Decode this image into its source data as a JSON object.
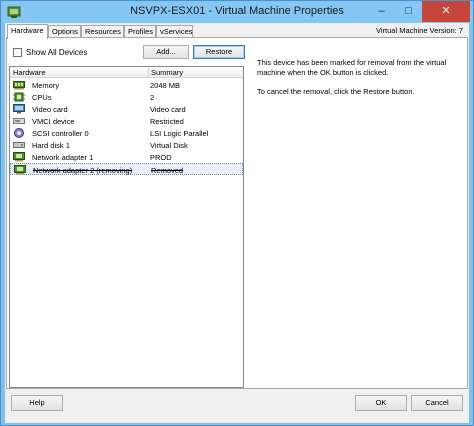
{
  "window": {
    "title": "NSVPX-ESX01 - Virtual Machine Properties",
    "minimize_glyph": "–",
    "maximize_glyph": "□",
    "close_glyph": "✕"
  },
  "tabs": [
    {
      "label": "Hardware",
      "active": true
    },
    {
      "label": "Options",
      "active": false
    },
    {
      "label": "Resources",
      "active": false
    },
    {
      "label": "Profiles",
      "active": false
    },
    {
      "label": "vServices",
      "active": false
    }
  ],
  "vm_version": "Virtual Machine Version: 7",
  "toolbar": {
    "show_all_label": "Show All Devices",
    "show_all_checked": false,
    "add_label": "Add...",
    "restore_label": "Restore"
  },
  "hardware_table": {
    "columns": [
      "Hardware",
      "Summary"
    ],
    "rows": [
      {
        "icon": "memory-icon",
        "name": "Memory",
        "summary": "2048 MB"
      },
      {
        "icon": "cpu-icon",
        "name": "CPUs",
        "summary": "2"
      },
      {
        "icon": "video-card-icon",
        "name": "Video card",
        "summary": "Video card"
      },
      {
        "icon": "vmci-device-icon",
        "name": "VMCI device",
        "summary": "Restricted"
      },
      {
        "icon": "scsi-controller-icon",
        "name": "SCSI controller 0",
        "summary": "LSI Logic Parallel"
      },
      {
        "icon": "hard-disk-icon",
        "name": "Hard disk 1",
        "summary": "Virtual Disk"
      },
      {
        "icon": "network-adapter-icon",
        "name": "Network adapter 1",
        "summary": "PROD"
      },
      {
        "icon": "network-adapter-icon",
        "name": "Network adapter 2 (removing)",
        "summary": "Removed",
        "removing": true
      }
    ]
  },
  "info": {
    "message": "This device has been marked for removal from the virtual machine when the OK button is clicked.",
    "hint": "To cancel the removal, click the Restore button."
  },
  "footer": {
    "help_label": "Help",
    "ok_label": "OK",
    "cancel_label": "Cancel"
  },
  "colors": {
    "title_bar": "#84c6f4",
    "close_button": "#c7463c",
    "removing_row": "#e8eff8"
  }
}
